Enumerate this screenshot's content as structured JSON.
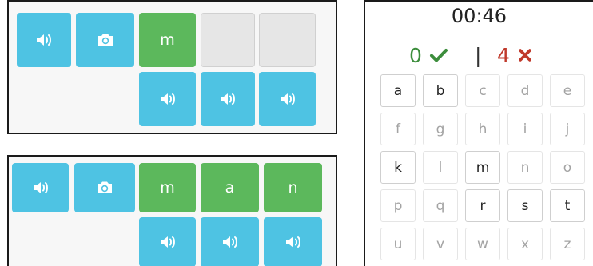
{
  "top_panel": {
    "row1": [
      {
        "kind": "audio",
        "icon": "speaker-icon"
      },
      {
        "kind": "photo",
        "icon": "camera-icon"
      },
      {
        "kind": "letter",
        "text": "m"
      },
      {
        "kind": "empty"
      },
      {
        "kind": "empty"
      }
    ],
    "row2": [
      {
        "kind": "audio",
        "icon": "speaker-icon"
      },
      {
        "kind": "audio",
        "icon": "speaker-icon"
      },
      {
        "kind": "audio",
        "icon": "speaker-icon"
      }
    ]
  },
  "bottom_panel": {
    "row1": [
      {
        "kind": "audio",
        "icon": "speaker-icon"
      },
      {
        "kind": "photo",
        "icon": "camera-icon"
      },
      {
        "kind": "letter",
        "text": "m"
      },
      {
        "kind": "letter",
        "text": "a"
      },
      {
        "kind": "letter",
        "text": "n"
      }
    ],
    "row2": [
      {
        "kind": "audio",
        "icon": "speaker-icon"
      },
      {
        "kind": "audio",
        "icon": "speaker-icon"
      },
      {
        "kind": "audio",
        "icon": "speaker-icon"
      }
    ]
  },
  "quiz": {
    "timer": "00:46",
    "correct_count": "0",
    "separator": "|",
    "wrong_count": "4",
    "icons": {
      "correct": "check-icon",
      "wrong": "cross-icon"
    },
    "colors": {
      "correct": "#3c8d3c",
      "wrong": "#c0392b",
      "audio_tile": "#4ec3e3",
      "letter_tile": "#5cb85c"
    },
    "keys": [
      {
        "letter": "a",
        "active": true
      },
      {
        "letter": "b",
        "active": true
      },
      {
        "letter": "c",
        "active": false
      },
      {
        "letter": "d",
        "active": false
      },
      {
        "letter": "e",
        "active": false
      },
      {
        "letter": "f",
        "active": false
      },
      {
        "letter": "g",
        "active": false
      },
      {
        "letter": "h",
        "active": false
      },
      {
        "letter": "i",
        "active": false
      },
      {
        "letter": "j",
        "active": false
      },
      {
        "letter": "k",
        "active": true
      },
      {
        "letter": "l",
        "active": false
      },
      {
        "letter": "m",
        "active": true
      },
      {
        "letter": "n",
        "active": false
      },
      {
        "letter": "o",
        "active": false
      },
      {
        "letter": "p",
        "active": false
      },
      {
        "letter": "q",
        "active": false
      },
      {
        "letter": "r",
        "active": true
      },
      {
        "letter": "s",
        "active": true
      },
      {
        "letter": "t",
        "active": true
      },
      {
        "letter": "u",
        "active": false
      },
      {
        "letter": "v",
        "active": false
      },
      {
        "letter": "w",
        "active": false
      },
      {
        "letter": "x",
        "active": false
      },
      {
        "letter": "z",
        "active": false
      }
    ]
  }
}
